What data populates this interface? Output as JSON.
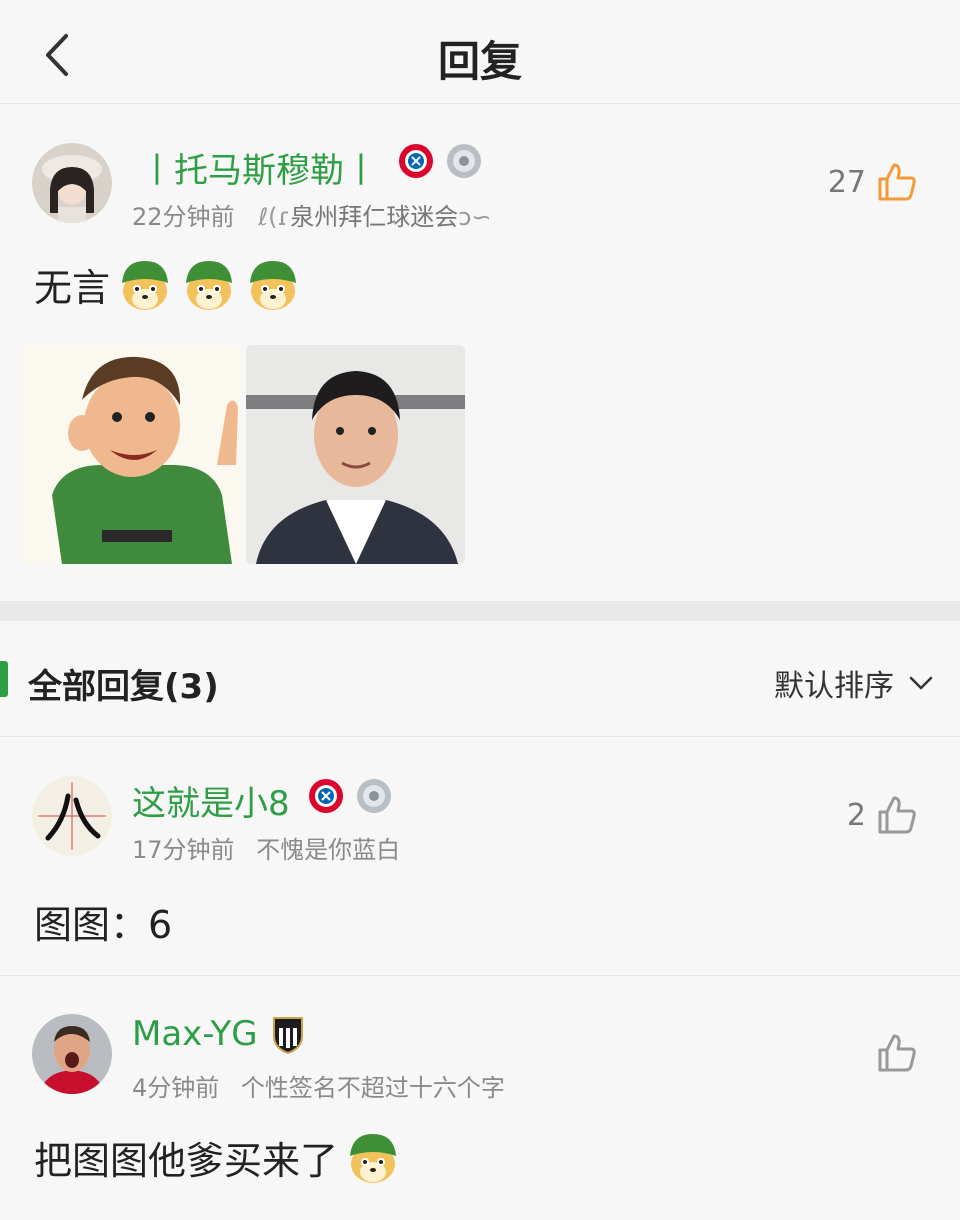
{
  "header": {
    "title": "回复"
  },
  "post": {
    "username": "丨托马斯穆勒丨",
    "time": "22分钟前",
    "club": "泉州拜仁球迷会",
    "likes": "27",
    "content": "无言",
    "doge_count": 3,
    "badges": [
      "fc-bayern-badge",
      "silver-plate-badge"
    ]
  },
  "replies_section": {
    "title": "全部回复(3)",
    "sort_label": "默认排序"
  },
  "replies": [
    {
      "username": "这就是小8",
      "time": "17分钟前",
      "signature": "不愧是你蓝白",
      "likes": "2",
      "content": "图图：6"
    },
    {
      "username": "Max-YG",
      "time": "4分钟前",
      "signature": "个性签名不超过十六个字",
      "likes": "",
      "content": "把图图他爹买来了"
    }
  ],
  "colors": {
    "accent": "#2e9e45",
    "like_active": "#f29b38",
    "background": "#f7f7f7"
  }
}
